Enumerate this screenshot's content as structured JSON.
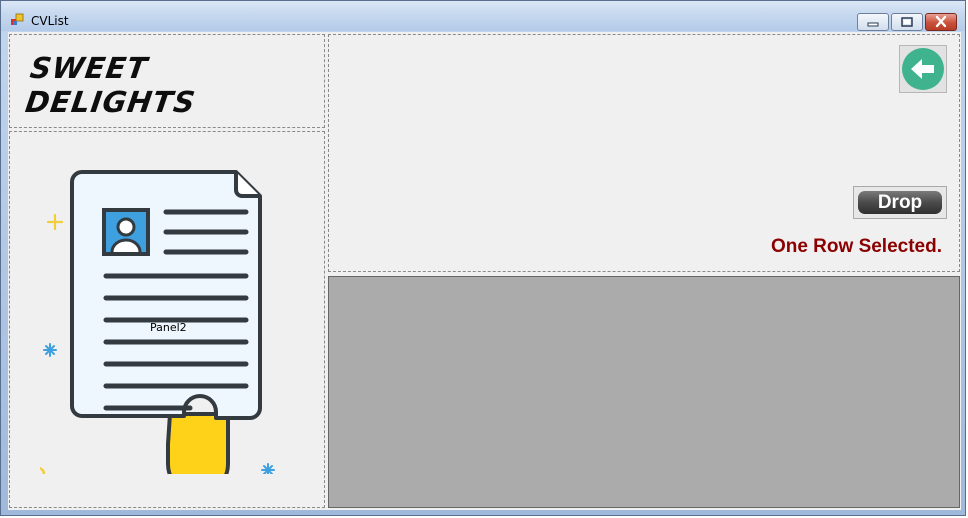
{
  "window": {
    "title": "CVList",
    "icons": {
      "app": "app-icon",
      "minimize": "minimize-icon",
      "maximize": "maximize-icon",
      "close": "close-icon"
    }
  },
  "header": {
    "brand": "SWEET DELIGHTS"
  },
  "image_panel": {
    "label": "Panel2",
    "illustration": "resume-document-illustration"
  },
  "actions": {
    "back_icon": "arrow-left-icon",
    "drop_label": "Drop",
    "status_text": "One Row Selected."
  },
  "colors": {
    "status": "#8b0000",
    "grid_background": "#ababab",
    "back_button": "#3fb28e",
    "document_accent": "#3fa0e0",
    "document_fold": "#ffd21a"
  }
}
